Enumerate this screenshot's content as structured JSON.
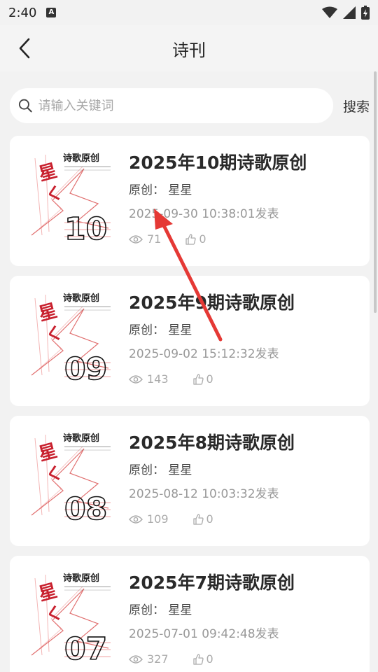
{
  "status": {
    "time": "2:40"
  },
  "header": {
    "title": "诗刊"
  },
  "search": {
    "placeholder": "请输入关键词",
    "button": "搜索"
  },
  "items": [
    {
      "title": "2025年10期诗歌原创",
      "author": "原创：  星星",
      "date": "2025-09-30 10:38:01发表",
      "views": "71",
      "likes": "0",
      "cover_number": "10"
    },
    {
      "title": "2025年9期诗歌原创",
      "author": "原创：  星星",
      "date": "2025-09-02 15:12:32发表",
      "views": "143",
      "likes": "0",
      "cover_number": "09"
    },
    {
      "title": "2025年8期诗歌原创",
      "author": "原创：  星星",
      "date": "2025-08-12 10:03:32发表",
      "views": "109",
      "likes": "0",
      "cover_number": "08"
    },
    {
      "title": "2025年7期诗歌原创",
      "author": "原创：  星星",
      "date": "2025-07-01 09:42:48发表",
      "views": "327",
      "likes": "0",
      "cover_number": "07"
    }
  ],
  "cover_heading": "诗歌原创",
  "colors": {
    "accent_red": "#c8202e",
    "arrow": "#e53935"
  }
}
